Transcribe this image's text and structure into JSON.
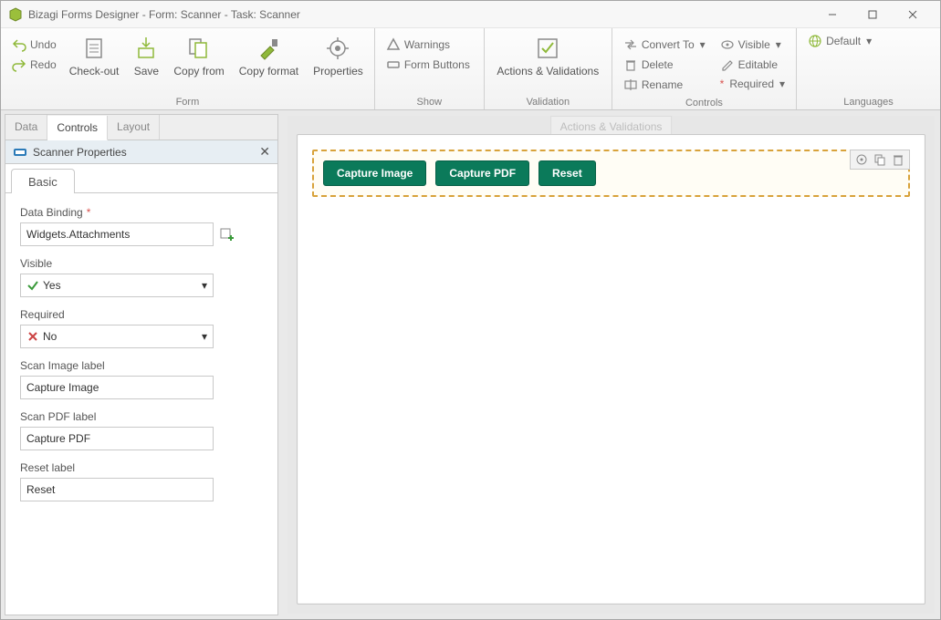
{
  "title": "Bizagi Forms Designer  - Form: Scanner - Task:  Scanner",
  "ribbon": {
    "form": {
      "label": "Form",
      "undo": "Undo",
      "redo": "Redo",
      "checkout": "Check-out",
      "save": "Save",
      "copyfrom": "Copy from",
      "copyformat": "Copy format",
      "properties": "Properties"
    },
    "show": {
      "label": "Show",
      "warnings": "Warnings",
      "formbuttons": "Form Buttons"
    },
    "validation": {
      "label": "Validation",
      "actions": "Actions & Validations"
    },
    "controls": {
      "label": "Controls",
      "convertto": "Convert To",
      "delete": "Delete",
      "rename": "Rename",
      "visible": "Visible",
      "editable": "Editable",
      "required": "Required"
    },
    "languages": {
      "label": "Languages",
      "default": "Default"
    }
  },
  "left": {
    "tabs": {
      "data": "Data",
      "controls": "Controls",
      "layout": "Layout"
    },
    "panel_title": "Scanner Properties",
    "subtab_basic": "Basic",
    "fields": {
      "databinding": {
        "label": "Data Binding",
        "value": "Widgets.Attachments"
      },
      "visible": {
        "label": "Visible",
        "value": "Yes"
      },
      "required": {
        "label": "Required",
        "value": "No"
      },
      "scanimage": {
        "label": "Scan Image label",
        "value": "Capture Image"
      },
      "scanpdf": {
        "label": "Scan PDF label",
        "value": "Capture PDF"
      },
      "reset": {
        "label": "Reset label",
        "value": "Reset"
      }
    }
  },
  "canvas": {
    "ghost_tab": "Actions & Validations",
    "buttons": {
      "capture_image": "Capture Image",
      "capture_pdf": "Capture PDF",
      "reset": "Reset"
    }
  }
}
